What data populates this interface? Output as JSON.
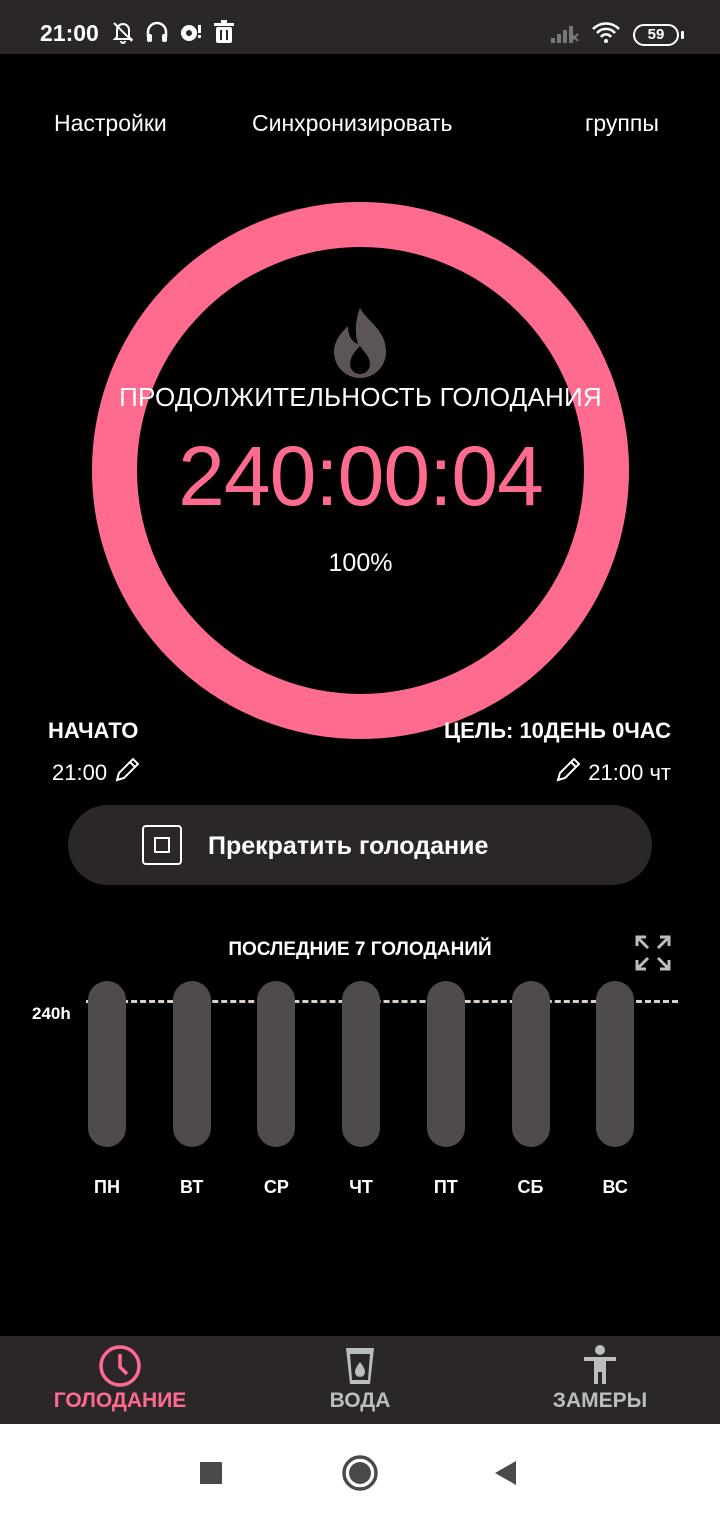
{
  "status_bar": {
    "time": "21:00",
    "battery": "59",
    "icons_left": [
      "bell-off-icon",
      "headphones-icon",
      "vpn-icon",
      "trash-icon"
    ],
    "icons_right": [
      "signal-icon",
      "wifi-icon",
      "battery-icon"
    ]
  },
  "top_nav": {
    "settings": "Настройки",
    "sync": "Синхронизировать",
    "groups": "группы"
  },
  "ring": {
    "label": "ПРОДОЛЖИТЕЛЬНОСТЬ ГОЛОДАНИЯ",
    "timer": "240:00:04",
    "percent": "100%",
    "progress": 1.0,
    "color": "#ff6b8f",
    "icon": "flame-icon"
  },
  "start": {
    "title": "НАЧАТО",
    "time": "21:00"
  },
  "goal": {
    "title": "ЦЕЛЬ: 10ДЕНЬ 0ЧАС",
    "time": "21:00 чт"
  },
  "stop_button": {
    "label": "Прекратить голодание"
  },
  "chart": {
    "title": "ПОСЛЕДНИЕ 7 ГОЛОДАНИЙ",
    "goal_label": "240h"
  },
  "chart_data": {
    "type": "bar",
    "title": "ПОСЛЕДНИЕ 7 ГОЛОДАНИЙ",
    "categories": [
      "ПН",
      "ВТ",
      "СР",
      "ЧТ",
      "ПТ",
      "СБ",
      "ВС"
    ],
    "values": [
      0,
      0,
      0,
      0,
      0,
      0,
      0
    ],
    "goal_line": 240,
    "goal_label": "240h",
    "ylabel": "",
    "xlabel": ""
  },
  "bottom_nav": {
    "items": [
      {
        "label": "ГОЛОДАНИЕ",
        "icon": "clock-icon",
        "active": true
      },
      {
        "label": "ВОДА",
        "icon": "water-glass-icon",
        "active": false
      },
      {
        "label": "ЗАМЕРЫ",
        "icon": "body-icon",
        "active": false
      }
    ],
    "active_color": "#ff6b8f",
    "inactive_color": "#bdbdbd"
  },
  "system_nav": {
    "buttons": [
      "recents-icon",
      "home-icon",
      "back-icon"
    ]
  }
}
